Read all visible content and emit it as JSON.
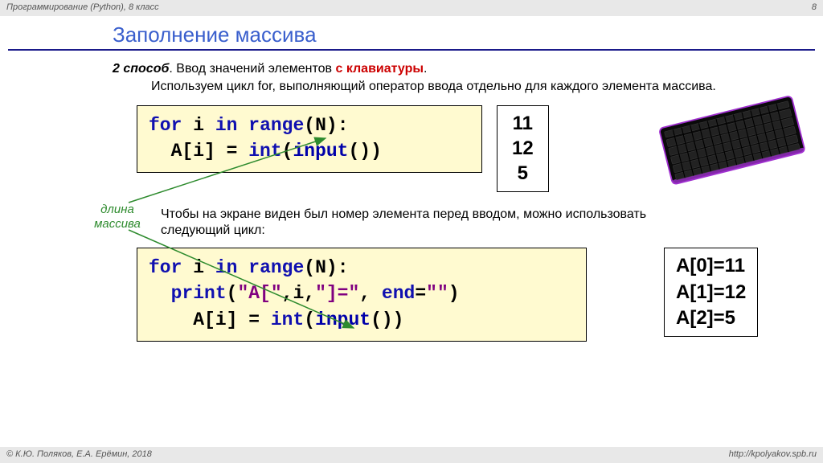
{
  "header": {
    "left": "Программирование (Python), 8 класс",
    "right": "8"
  },
  "title": "Заполнение массива",
  "method": {
    "label": "2 способ",
    "text": ". Ввод значений элементов ",
    "highlight": "с клавиатуры",
    "tail": "."
  },
  "desc": "Используем цикл for, выполняющий оператор ввода отдельно для каждого элемента массива.",
  "code1": {
    "l1": {
      "a": "for",
      "b": " i ",
      "c": "in",
      "d": " ",
      "e": "range",
      "f": "(N):"
    },
    "l2": {
      "a": "  A[i] = ",
      "b": "int",
      "c": "(",
      "d": "input",
      "e": "())"
    }
  },
  "output1": {
    "l1": "11",
    "l2": "12",
    "l3": "5"
  },
  "label_len": {
    "l1": "длина",
    "l2": "массива"
  },
  "para2": "Чтобы на экране виден был номер элемента перед вводом, можно использовать следующий цикл:",
  "code2": {
    "l1": {
      "a": "for",
      "b": " i ",
      "c": "in",
      "d": " ",
      "e": "range",
      "f": "(N):"
    },
    "l2": {
      "a": "  ",
      "b": "print",
      "c": "(",
      "d": "\"A[\"",
      "e": ",i,",
      "f": "\"]=\"",
      "g": ", ",
      "h": "end",
      "i": "=",
      "j": "\"\"",
      "k": ")"
    },
    "l3": {
      "a": "    A[i] = ",
      "b": "int",
      "c": "(",
      "d": "input",
      "e": "())"
    }
  },
  "output2": {
    "l1": "A[0]=11",
    "l2": "A[1]=12",
    "l3": "A[2]=5"
  },
  "footer": {
    "left": "© К.Ю. Поляков, Е.А. Ерёмин, 2018",
    "right": "http://kpolyakov.spb.ru"
  }
}
